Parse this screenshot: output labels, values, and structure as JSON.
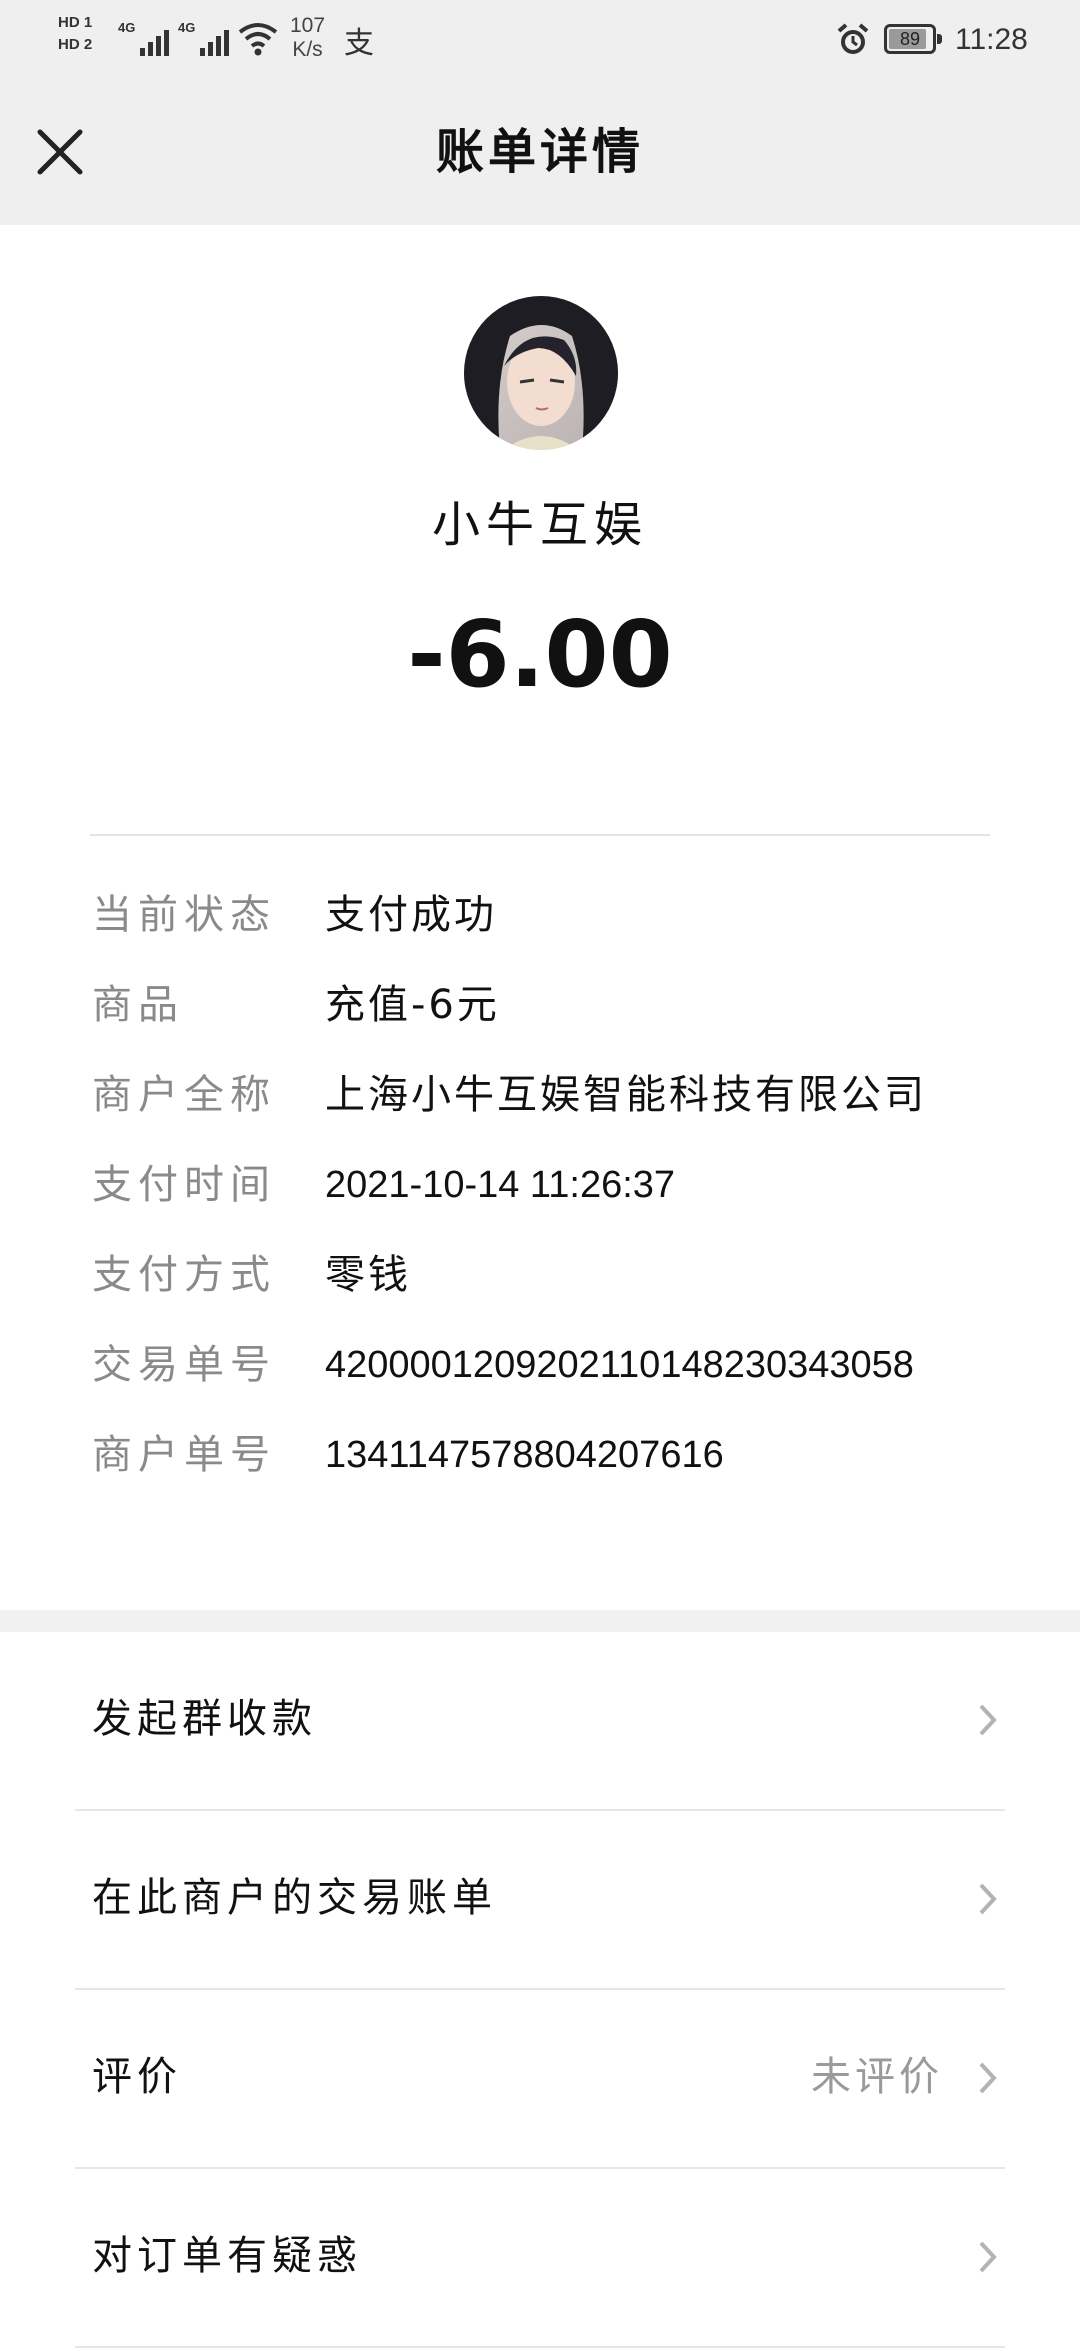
{
  "status_bar": {
    "hd1": "HD 1",
    "hd2": "HD 2",
    "net1": "4G",
    "net2": "4G",
    "speed_value": "107",
    "speed_unit": "K/s",
    "pay_icon_char": "支",
    "battery_level": 89,
    "battery_text": "89",
    "time": "11:28"
  },
  "header": {
    "title": "账单详情"
  },
  "merchant": {
    "name": "小牛互娱",
    "amount": "-6.00"
  },
  "details": [
    {
      "label": "当前状态",
      "value": "支付成功",
      "numeric": false
    },
    {
      "label": "商品",
      "value": "充值-6元",
      "numeric": false
    },
    {
      "label": "商户全称",
      "value": "上海小牛互娱智能科技有限公司",
      "numeric": false
    },
    {
      "label": "支付时间",
      "value": "2021-10-14 11:26:37",
      "numeric": true
    },
    {
      "label": "支付方式",
      "value": "零钱",
      "numeric": false
    },
    {
      "label": "交易单号",
      "value": "4200001209202110148230343058",
      "numeric": true
    },
    {
      "label": "商户单号",
      "value": "1341147578804207616",
      "numeric": true
    }
  ],
  "actions": [
    {
      "label": "发起群收款",
      "aside": ""
    },
    {
      "label": "在此商户的交易账单",
      "aside": ""
    },
    {
      "label": "评价",
      "aside": "未评价"
    },
    {
      "label": "对订单有疑惑",
      "aside": ""
    }
  ],
  "colors": {
    "header_bg": "#efefef",
    "label_gray": "#8a8a8a",
    "text_dark": "#111111"
  }
}
